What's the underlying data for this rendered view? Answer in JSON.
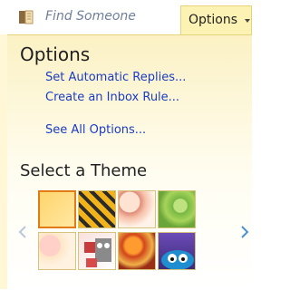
{
  "header": {
    "search_placeholder": "Find Someone",
    "options_tab": "Options"
  },
  "options": {
    "title": "Options",
    "links": [
      "Set Automatic Replies...",
      "Create an Inbox Rule...",
      "See All Options..."
    ]
  },
  "themes": {
    "title": "Select a Theme",
    "items": [
      {
        "name": "theme-yellow",
        "selected": true
      },
      {
        "name": "theme-tiger"
      },
      {
        "name": "theme-sketch"
      },
      {
        "name": "theme-green"
      },
      {
        "name": "theme-floral"
      },
      {
        "name": "theme-robot"
      },
      {
        "name": "theme-fall"
      },
      {
        "name": "theme-monster"
      }
    ]
  },
  "colors": {
    "accent_tab": "#fcf2b3",
    "selected_border": "#e27a17",
    "link": "#1a3cc5"
  }
}
